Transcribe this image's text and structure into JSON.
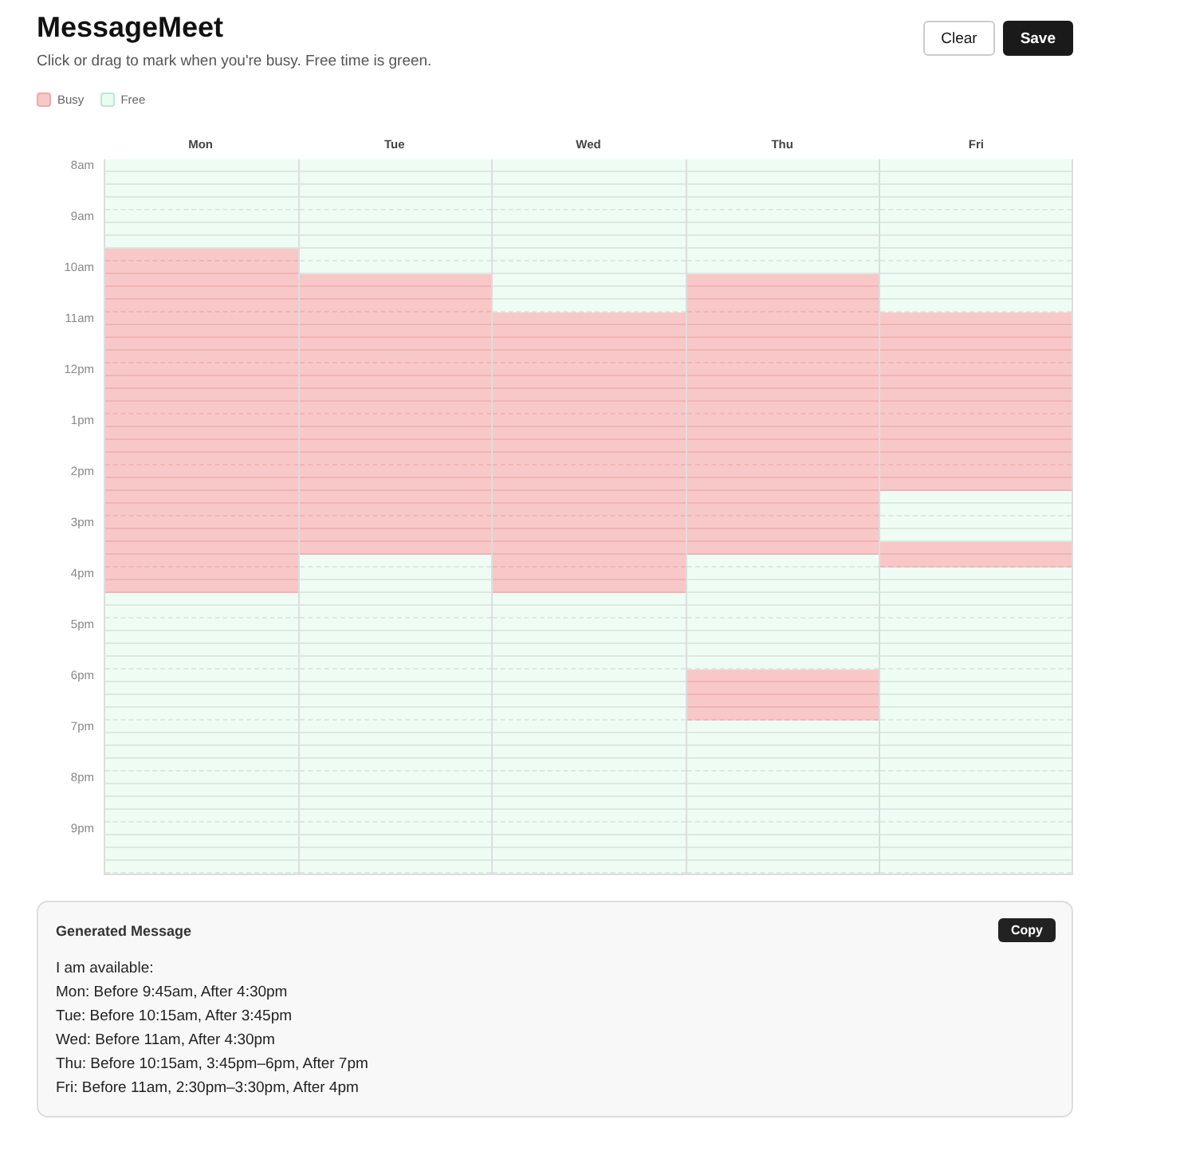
{
  "header": {
    "title": "MessageMeet",
    "subtitle": "Click or drag to mark when you're busy. Free time is green."
  },
  "buttons": [
    {
      "label": "Clear",
      "kind": "secondary"
    },
    {
      "label": "Save",
      "kind": "primary"
    }
  ],
  "legend": [
    {
      "label": "Busy",
      "color": "#f8c8c8"
    },
    {
      "label": "Free",
      "color": "#ecfbf2"
    }
  ],
  "times": [
    "8am",
    "9am",
    "10am",
    "11am",
    "12pm",
    "1pm",
    "2pm",
    "3pm",
    "4pm",
    "5pm",
    "6pm",
    "7pm",
    "8pm",
    "9pm"
  ],
  "days": [
    {
      "label": "Mon",
      "busy": [
        false,
        false,
        false,
        false,
        false,
        false,
        false,
        true,
        true,
        true,
        true,
        true,
        true,
        true,
        true,
        true,
        true,
        true,
        true,
        true,
        true,
        true,
        true,
        true,
        true,
        true,
        true,
        true,
        true,
        true,
        true,
        true,
        true,
        true,
        false,
        false,
        false,
        false,
        false,
        false,
        false,
        false,
        false,
        false,
        false,
        false,
        false,
        false,
        false,
        false,
        false,
        false,
        false,
        false,
        false,
        false
      ]
    },
    {
      "label": "Tue",
      "busy": [
        false,
        false,
        false,
        false,
        false,
        false,
        false,
        false,
        false,
        true,
        true,
        true,
        true,
        true,
        true,
        true,
        true,
        true,
        true,
        true,
        true,
        true,
        true,
        true,
        true,
        true,
        true,
        true,
        true,
        true,
        true,
        false,
        false,
        false,
        false,
        false,
        false,
        false,
        false,
        false,
        false,
        false,
        false,
        false,
        false,
        false,
        false,
        false,
        false,
        false,
        false,
        false,
        false,
        false,
        false,
        false
      ]
    },
    {
      "label": "Wed",
      "busy": [
        false,
        false,
        false,
        false,
        false,
        false,
        false,
        false,
        false,
        false,
        false,
        false,
        true,
        true,
        true,
        true,
        true,
        true,
        true,
        true,
        true,
        true,
        true,
        true,
        true,
        true,
        true,
        true,
        true,
        true,
        true,
        true,
        true,
        true,
        false,
        false,
        false,
        false,
        false,
        false,
        false,
        false,
        false,
        false,
        false,
        false,
        false,
        false,
        false,
        false,
        false,
        false,
        false,
        false,
        false,
        false
      ]
    },
    {
      "label": "Thu",
      "busy": [
        false,
        false,
        false,
        false,
        false,
        false,
        false,
        false,
        false,
        true,
        true,
        true,
        true,
        true,
        true,
        true,
        true,
        true,
        true,
        true,
        true,
        true,
        true,
        true,
        true,
        true,
        true,
        true,
        true,
        true,
        true,
        false,
        false,
        false,
        false,
        false,
        false,
        false,
        false,
        false,
        true,
        true,
        true,
        true,
        false,
        false,
        false,
        false,
        false,
        false,
        false,
        false,
        false,
        false,
        false,
        false
      ]
    },
    {
      "label": "Fri",
      "busy": [
        false,
        false,
        false,
        false,
        false,
        false,
        false,
        false,
        false,
        false,
        false,
        false,
        true,
        true,
        true,
        true,
        true,
        true,
        true,
        true,
        true,
        true,
        true,
        true,
        true,
        true,
        false,
        false,
        false,
        false,
        true,
        true,
        false,
        false,
        false,
        false,
        false,
        false,
        false,
        false,
        false,
        false,
        false,
        false,
        false,
        false,
        false,
        false,
        false,
        false,
        false,
        false,
        false,
        false,
        false,
        false
      ]
    }
  ],
  "message": {
    "title": "Generated Message",
    "button": "Copy",
    "lines": [
      "I am available:",
      "Mon: Before 9:45am, After 4:30pm",
      "Tue: Before 10:15am, After 3:45pm",
      "Wed: Before 11am, After 4:30pm",
      "Thu: Before 10:15am, 3:45pm–6pm, After 7pm",
      "Fri: Before 11am, 2:30pm–3:30pm, After 4pm"
    ]
  }
}
